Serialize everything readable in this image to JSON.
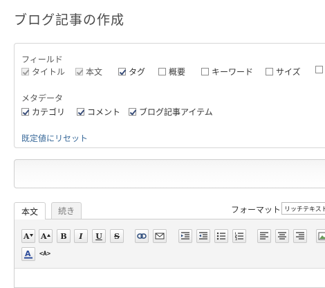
{
  "page": {
    "title": "ブログ記事の作成"
  },
  "fields": {
    "label": "フィールド",
    "items": [
      {
        "label": "タイトル",
        "checked": true,
        "disabled": true
      },
      {
        "label": "本文",
        "checked": true,
        "disabled": true
      },
      {
        "label": "タグ",
        "checked": true,
        "disabled": false
      },
      {
        "label": "概要",
        "checked": false,
        "disabled": false
      },
      {
        "label": "キーワード",
        "checked": false,
        "disabled": false
      },
      {
        "label": "サイズ",
        "checked": false,
        "disabled": false
      },
      {
        "label": "",
        "checked": false,
        "disabled": false
      }
    ]
  },
  "metadata": {
    "label": "メタデータ",
    "items": [
      {
        "label": "カテゴリ",
        "checked": true
      },
      {
        "label": "コメント",
        "checked": true
      },
      {
        "label": "ブログ記事アイテム",
        "checked": true
      }
    ]
  },
  "reset_link": "既定値にリセット",
  "editor": {
    "tabs": [
      {
        "label": "本文"
      },
      {
        "label": "続き"
      }
    ],
    "format_label": "フォーマット:",
    "format_value": "リッチテキスト",
    "toolbar_icons": [
      "font-size-decrease-icon",
      "font-size-increase-icon",
      "bold-icon",
      "italic-icon",
      "underline-icon",
      "strikethrough-icon",
      "link-icon",
      "email-icon",
      "indent-icon",
      "outdent-icon",
      "bulleted-list-icon",
      "numbered-list-icon",
      "align-left-icon",
      "align-center-icon",
      "align-right-icon",
      "image-icon",
      "text-color-icon",
      "html-source-icon"
    ],
    "toolbar_glyphs": {
      "bold": "B",
      "italic": "I",
      "underline": "U",
      "strike": "S",
      "decrease": "A",
      "increase": "A",
      "html": "<A>"
    }
  }
}
